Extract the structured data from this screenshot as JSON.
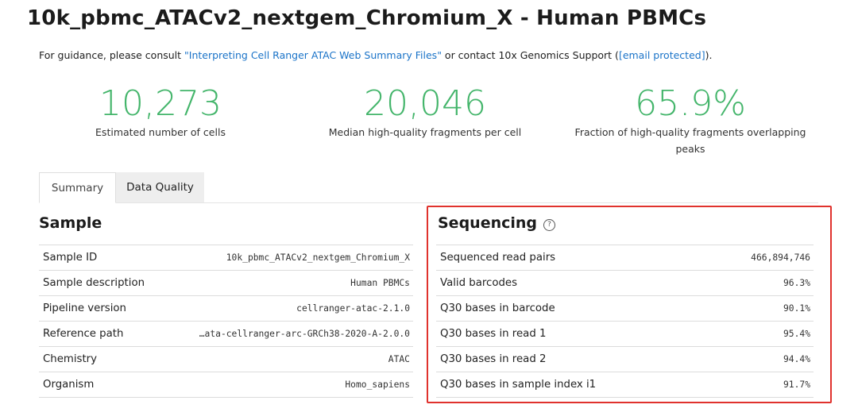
{
  "header": {
    "title": "10k_pbmc_ATACv2_nextgem_Chromium_X - Human PBMCs",
    "guidance_prefix": "For guidance, please consult ",
    "guidance_link": "\"Interpreting Cell Ranger ATAC Web Summary Files\"",
    "guidance_middle": " or contact 10x Genomics Support (",
    "guidance_email": "[email protected]",
    "guidance_suffix": ")."
  },
  "metrics": [
    {
      "value": "10,273",
      "label": "Estimated number of cells"
    },
    {
      "value": "20,046",
      "label": "Median high-quality fragments per cell"
    },
    {
      "value": "65.9%",
      "label": "Fraction of high-quality fragments overlapping peaks"
    }
  ],
  "tabs": [
    {
      "label": "Summary",
      "active": true
    },
    {
      "label": "Data Quality",
      "active": false
    }
  ],
  "sample": {
    "title": "Sample",
    "rows": [
      {
        "key": "Sample ID",
        "value": "10k_pbmc_ATACv2_nextgem_Chromium_X"
      },
      {
        "key": "Sample description",
        "value": "Human PBMCs"
      },
      {
        "key": "Pipeline version",
        "value": "cellranger-atac-2.1.0"
      },
      {
        "key": "Reference path",
        "value": "…ata-cellranger-arc-GRCh38-2020-A-2.0.0"
      },
      {
        "key": "Chemistry",
        "value": "ATAC"
      },
      {
        "key": "Organism",
        "value": "Homo_sapiens"
      }
    ]
  },
  "sequencing": {
    "title": "Sequencing",
    "help_icon": "help-circle-icon",
    "help_glyph": "?",
    "rows": [
      {
        "key": "Sequenced read pairs",
        "value": "466,894,746"
      },
      {
        "key": "Valid barcodes",
        "value": "96.3%"
      },
      {
        "key": "Q30 bases in barcode",
        "value": "90.1%"
      },
      {
        "key": "Q30 bases in read 1",
        "value": "95.4%"
      },
      {
        "key": "Q30 bases in read 2",
        "value": "94.4%"
      },
      {
        "key": "Q30 bases in sample index i1",
        "value": "91.7%"
      }
    ]
  },
  "colors": {
    "metric_green": "#44b56b",
    "link_blue": "#1a73c8",
    "highlight_red": "#e0322d"
  }
}
